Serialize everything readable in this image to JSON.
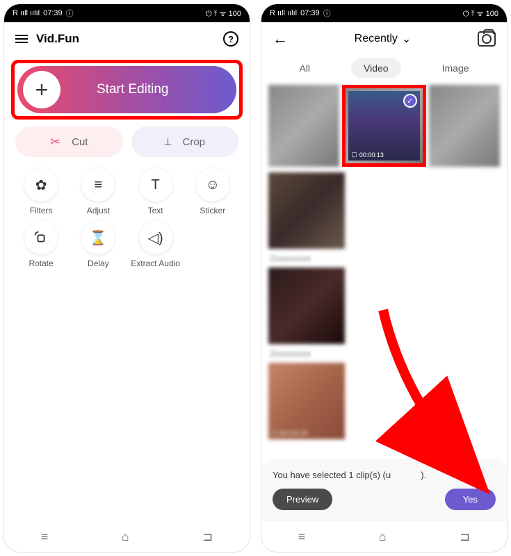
{
  "status": {
    "time": "07:39",
    "signal": "R ııll ıılıl",
    "right": "⏻ ⤒ ᯤ 100"
  },
  "left": {
    "app_title": "Vid.Fun",
    "start_editing_label": "Start Editing",
    "tools": {
      "cut": "Cut",
      "crop": "Crop"
    },
    "grid": [
      {
        "icon": "✿",
        "label": "Filters"
      },
      {
        "icon": "≡",
        "label": "Adjust"
      },
      {
        "icon": "T",
        "label": "Text"
      },
      {
        "icon": "☺",
        "label": "Sticker"
      },
      {
        "icon": "⟲▢",
        "label": "Rotate"
      },
      {
        "icon": "⌛",
        "label": "Delay"
      },
      {
        "icon": "◁)",
        "label": "Extract Audio"
      }
    ]
  },
  "right": {
    "folder_label": "Recently",
    "tabs": {
      "all": "All",
      "video": "Video",
      "image": "Image"
    },
    "selected_duration": "00:00:13",
    "bottom_thumb_duration": "UU.UU.18",
    "sheet_message": "You have selected 1 clip(s) (u",
    "preview_label": "Preview",
    "yes_label": "Yes"
  }
}
